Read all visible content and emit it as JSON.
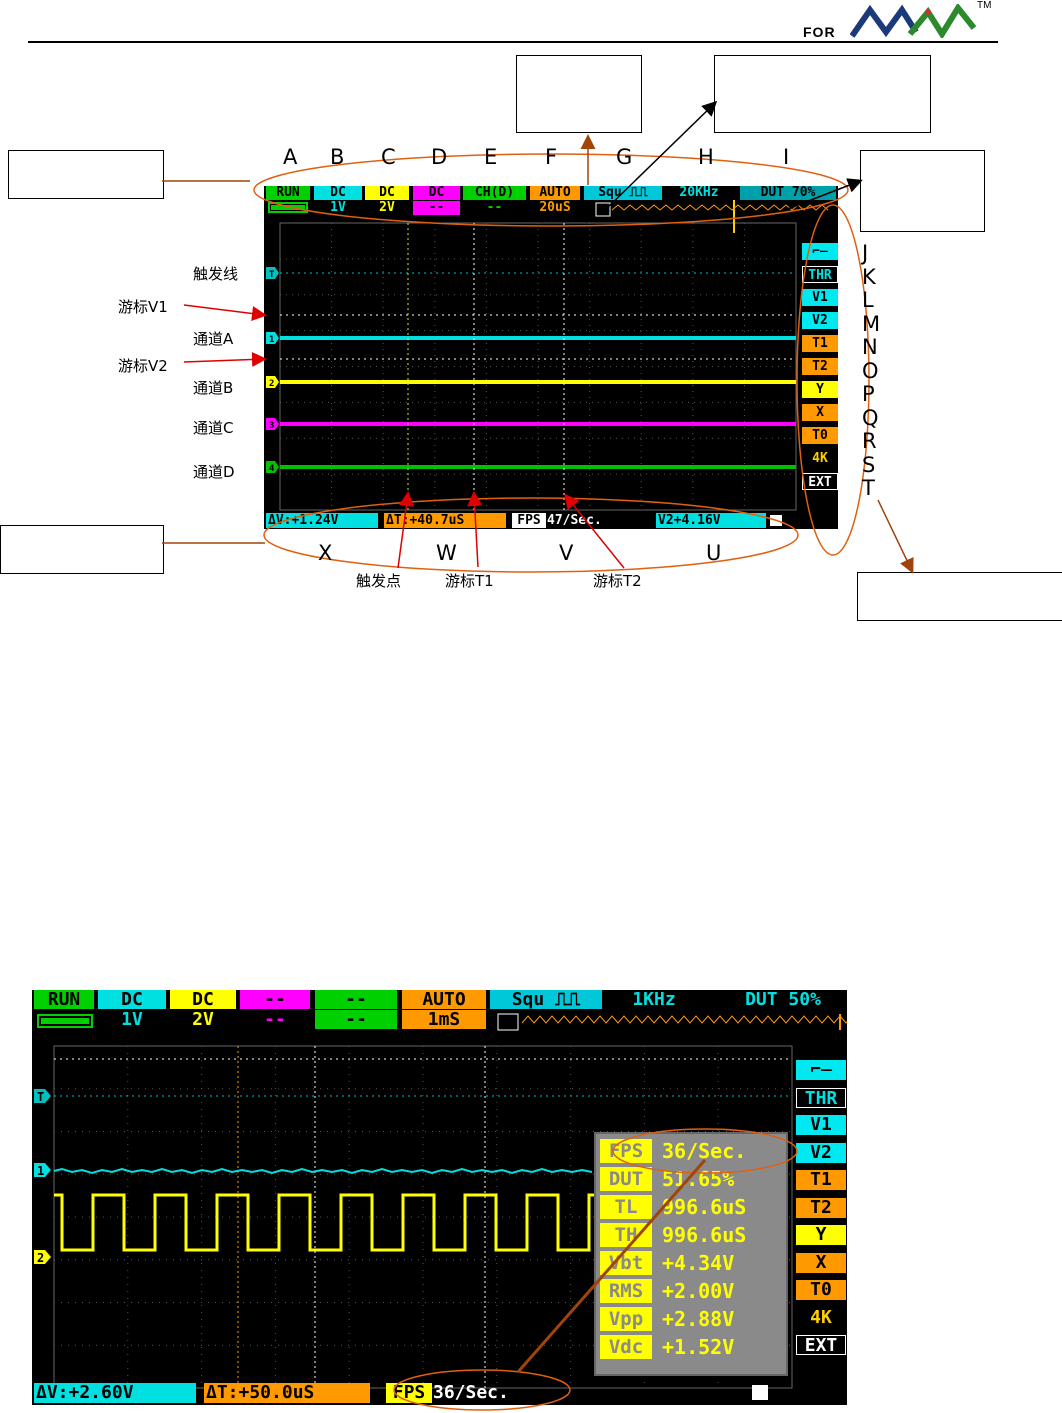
{
  "brand": {
    "for_label": "FOR",
    "tm": "TM"
  },
  "figure1": {
    "letters_top": [
      "A",
      "B",
      "C",
      "D",
      "E",
      "F",
      "G",
      "H",
      "I"
    ],
    "letters_right": [
      "J",
      "K",
      "L",
      "M",
      "N",
      "O",
      "P",
      "Q",
      "R",
      "S",
      "T"
    ],
    "letters_bottom": [
      "X",
      "W",
      "V",
      "U"
    ],
    "left_labels": {
      "trigger_line": "触发线",
      "cursor_v1": "游标V1",
      "channel_a": "通道A",
      "cursor_v2": "游标V2",
      "channel_b": "通道B",
      "channel_c": "通道C",
      "channel_d": "通道D"
    },
    "bottom_labels": {
      "trigger_point": "触发点",
      "cursor_t1": "游标T1",
      "cursor_t2": "游标T2"
    },
    "screen": {
      "top_row": [
        {
          "top": "RUN",
          "bottom": ""
        },
        {
          "top": "DC",
          "bottom": "1V"
        },
        {
          "top": "DC",
          "bottom": "2V"
        },
        {
          "top": "DC",
          "bottom": "--"
        },
        {
          "top": "CH(D)",
          "bottom": "--"
        },
        {
          "top": "AUTO",
          "bottom": "20uS"
        },
        {
          "top": "Squ ⎍⎍",
          "bottom": ""
        },
        {
          "top": "20KHz",
          "bottom": ""
        },
        {
          "top": "DUT 70%",
          "bottom": ""
        }
      ],
      "side_buttons": [
        "⌐̶",
        "THR",
        "V1",
        "V2",
        "T1",
        "T2",
        "Y",
        "X",
        "T0",
        "4K",
        "EXT"
      ],
      "ch_markers": [
        "T",
        "1",
        "2",
        "3",
        "4"
      ],
      "bottom_bar": {
        "dv": "ΔV:+1.24V",
        "dt": "ΔT:+40.7uS",
        "fps_label": "FPS",
        "fps_value": "47/Sec.",
        "v2": "V2+4.16V"
      }
    }
  },
  "figure2": {
    "screen": {
      "top_row": [
        {
          "top": "RUN",
          "bottom": ""
        },
        {
          "top": "DC",
          "bottom": "1V"
        },
        {
          "top": "DC",
          "bottom": "2V"
        },
        {
          "top": "--",
          "bottom": "--"
        },
        {
          "top": "--",
          "bottom": "--"
        },
        {
          "top": "AUTO",
          "bottom": "1mS"
        },
        {
          "top": "Squ ⎍⎍",
          "bottom": ""
        },
        {
          "top": "1KHz",
          "bottom": ""
        },
        {
          "top": "DUT 50%",
          "bottom": ""
        }
      ],
      "side_buttons": [
        "⌐̶",
        "THR",
        "V1",
        "V2",
        "T1",
        "T2",
        "Y",
        "X",
        "T0",
        "4K",
        "EXT"
      ],
      "measurements": [
        {
          "name": "FPS",
          "value": "36/Sec."
        },
        {
          "name": "DUT",
          "value": "51.65%"
        },
        {
          "name": "TL",
          "value": "996.6uS"
        },
        {
          "name": "TH",
          "value": "996.6uS"
        },
        {
          "name": "Vbt",
          "value": "+4.34V"
        },
        {
          "name": "RMS",
          "value": "+2.00V"
        },
        {
          "name": "Vpp",
          "value": "+2.88V"
        },
        {
          "name": "Vdc",
          "value": "+1.52V"
        }
      ],
      "bottom_bar": {
        "dv": "ΔV:+2.60V",
        "dt": "ΔT:+50.0uS",
        "fps_label": "FPS",
        "fps_value": "36/Sec."
      }
    }
  },
  "colors": {
    "run": "#00d000",
    "cha": "#00e0e0",
    "chb": "#ffff00",
    "chc": "#ff00ff",
    "chd": "#00c000",
    "orange": "#ff9900",
    "cyan_btn": "#00e8f0",
    "info_panel": "#888888",
    "anno_line": "#a0440a"
  }
}
